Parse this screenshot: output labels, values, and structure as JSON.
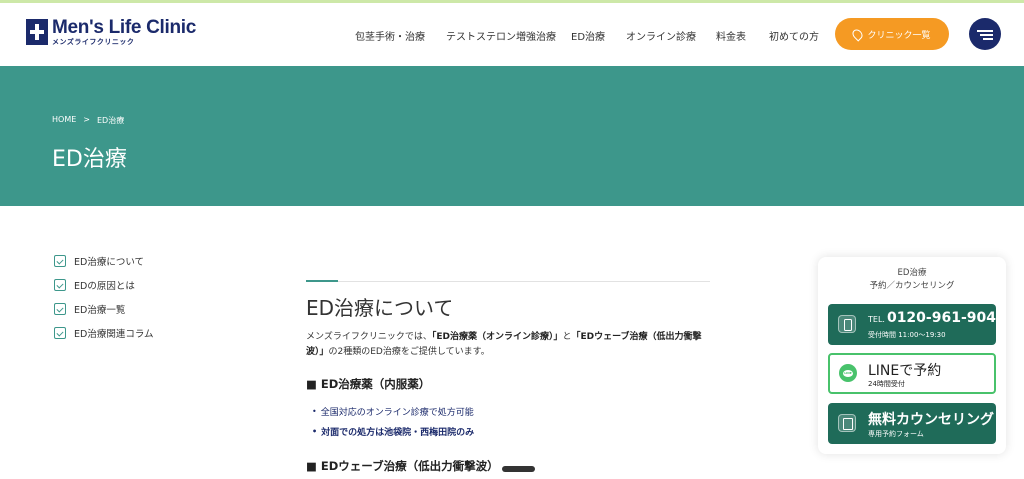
{
  "logo": {
    "main": "Men's Life Clinic",
    "sub": "メンズライフクリニック"
  },
  "nav": {
    "items": [
      "包茎手術・治療",
      "テストステロン増強治療",
      "ED治療",
      "オンライン診療",
      "料金表",
      "初めての方"
    ],
    "clinic_button": "クリニック一覧"
  },
  "hero": {
    "breadcrumb": {
      "home": "HOME",
      "sep": ">",
      "current": "ED治療"
    },
    "title": "ED治療"
  },
  "sidebar": {
    "items": [
      "ED治療について",
      "EDの原因とは",
      "ED治療一覧",
      "ED治療関連コラム"
    ]
  },
  "main": {
    "section_title": "ED治療について",
    "intro_prefix": "メンズライフクリニックでは、",
    "intro_bold1": "「ED治療薬（オンライン診療）」",
    "intro_mid": "と",
    "intro_bold2": "「EDウェーブ治療（低出力衝撃波）」",
    "intro_suffix": "の2種類のED治療をご提供しています。",
    "heading1": "■ ED治療薬（内服薬）",
    "bullets": [
      "全国対応のオンライン診療で処方可能",
      "対面での処方は池袋院・西梅田院のみ"
    ],
    "heading2": "■ EDウェーブ治療（低出力衝撃波）"
  },
  "panel": {
    "label_line1": "ED治療",
    "label_line2": "予約／カウンセリング",
    "tel_prefix": "TEL.",
    "tel_number": "0120-961-904",
    "tel_hours": "受付時間 11:00～19:30",
    "line_title": "LINEで予約",
    "line_sub": "24時間受付",
    "line_icon_text": "LINE",
    "counsel_title": "無料カウンセリング",
    "counsel_sub": "専用予約フォーム"
  },
  "colors": {
    "navy": "#1b2a6b",
    "teal": "#3d978b",
    "orange": "#f59a23",
    "green_dark": "#1f6b59",
    "line_green": "#48c26b"
  },
  "icons": [
    "logo-cross-icon",
    "location-pin-icon",
    "hamburger-menu-icon",
    "checkbox-icon",
    "phone-icon",
    "line-icon",
    "form-icon"
  ]
}
